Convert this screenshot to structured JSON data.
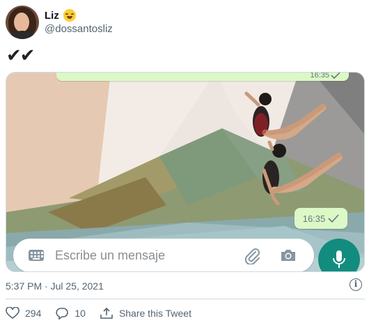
{
  "author": {
    "display_name": "Liz",
    "handle": "@dossantosliz",
    "emoji_icon": "grinning-face-smiling-eyes-icon"
  },
  "tweet": {
    "text": "✔✔"
  },
  "media": {
    "top_bubble_time": "16:35",
    "bubble_time": "16:35",
    "input_placeholder": "Escribe un mensaje",
    "colors": {
      "bubble": "#dcf8c6",
      "mic_button": "#128c7e",
      "tick": "#667781"
    }
  },
  "meta": {
    "timestamp": "5:37 PM · Jul 25, 2021"
  },
  "actions": {
    "likes": "294",
    "replies": "10",
    "share_label": "Share this Tweet"
  }
}
